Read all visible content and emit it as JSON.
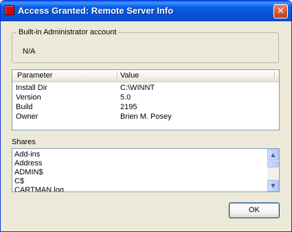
{
  "window": {
    "title": "Access Granted: Remote Server Info",
    "close_glyph": "✕",
    "app_icon": "red-square-icon"
  },
  "admin_group": {
    "legend": "Built-in Administrator account",
    "value": "N/A"
  },
  "params": {
    "headers": [
      "Parameter",
      "Value"
    ],
    "rows": [
      {
        "param": "Install Dir",
        "value": "C:\\WINNT"
      },
      {
        "param": "Version",
        "value": "5.0"
      },
      {
        "param": "Build",
        "value": "2195"
      },
      {
        "param": "Owner",
        "value": "Brien M. Posey"
      }
    ]
  },
  "shares": {
    "label": "Shares",
    "items": [
      "Add-ins",
      "Address",
      "ADMIN$",
      "C$",
      "CARTMAN.log"
    ],
    "scroll_up_glyph": "▲",
    "scroll_down_glyph": "▼"
  },
  "buttons": {
    "ok": "OK"
  },
  "colors": {
    "titlebar": "#0653d8",
    "window_bg": "#ece9d8",
    "close_button": "#d65a36"
  }
}
